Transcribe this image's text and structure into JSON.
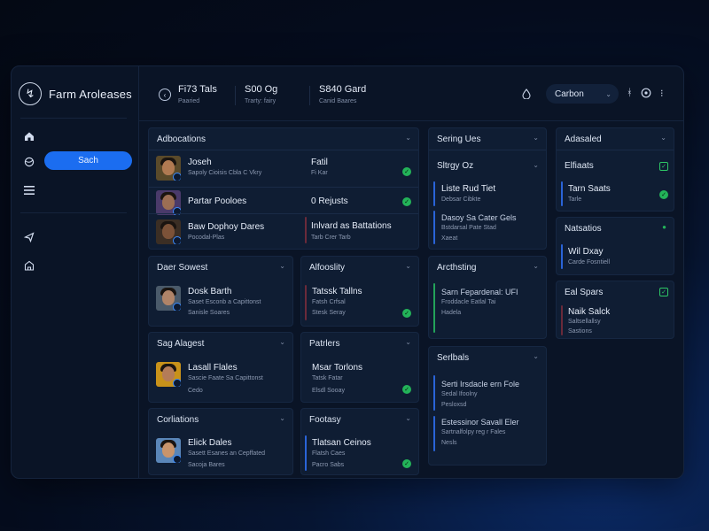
{
  "app": {
    "brand_mark": "↯",
    "title": "Farm Aroleases"
  },
  "sidebar": {
    "search_label": "Sach"
  },
  "topbar": {
    "stats": [
      {
        "value": "Fi73 Tals",
        "label": "Paaried"
      },
      {
        "value": "S00 Og",
        "label": "Trarty: fairy"
      },
      {
        "value": "S840 Gard",
        "label": "Canid Baares"
      }
    ],
    "select_value": "Carbon"
  },
  "cards": {
    "adbocations": {
      "title": "Adbocations",
      "rows": [
        {
          "name": "Joseh",
          "sub": "Sapoly Cioisis Cbla C Vkry",
          "right_title": "Fatil",
          "right_sub": "Fi Kar"
        },
        {
          "name": "Partar Pooloes",
          "right_title": "0 Rejusts"
        },
        {
          "name": "Baw Dophoy Dares",
          "sub": "Pocodal-Plas",
          "right_title": "Inlvard as Battations",
          "right_sub": "Tarb Crer Tarb"
        }
      ]
    },
    "daer": {
      "title": "Daer Sowest",
      "name": "Dosk Barth",
      "sub1": "Saset Esconb a Capittonst",
      "sub2": "Sanisle Soares"
    },
    "sag": {
      "title": "Sag Alagest",
      "name": "Lasall Flales",
      "sub1": "Sascie Faate Sa Capittonst",
      "sub2": "Cedo"
    },
    "corlations": {
      "title": "Corliations",
      "name": "Elick Dales",
      "sub1": "Sasett Esanes an Cepffated",
      "sub2": "Sacoja Bares"
    },
    "alfooslity": {
      "title": "Alfooslity",
      "name": "Tatssk Tallns",
      "sub1": "Fatsh Crfsal",
      "sub2": "Stesk Seray"
    },
    "patrlers": {
      "title": "Patrlers",
      "name": "Msar Torlons",
      "sub1": "Tatsk Fatar",
      "sub2": "Elsdl Sooay"
    },
    "footasy": {
      "title": "Footasy",
      "name": "Tlatsan Ceinos",
      "sub1": "Flatsh Caes",
      "sub2": "Pacro Sabs"
    },
    "sering": {
      "title": "Sering Ues",
      "sub_title": "Sltrgy Oz",
      "lines1": [
        "Liste Rud Tiet",
        "Debsar Cibkte"
      ],
      "lines2": [
        "Dasoy Sa Cater Gels",
        "Bstdarsal Pate Stad",
        "Xaeat"
      ]
    },
    "archsting": {
      "title": "Arcthsting",
      "lines": [
        "Sarn Fepardenal: UFI",
        "Froddacle Eatlal Tai",
        "Hadela"
      ]
    },
    "serlbals": {
      "title": "Serlbals",
      "lines1": [
        "Serti Irsdacle ern Fole",
        "Sedal Ifoolny",
        "Pesloxsd"
      ],
      "lines2": [
        "Estessinor Savall Eler",
        "Sartnalfolpy reg r Fales",
        "Nesls"
      ]
    },
    "adasaled": {
      "title": "Adasaled",
      "sub_title": "Elfiaats",
      "name": "Tarn Saats",
      "sub": "Tarle"
    },
    "natsatios": {
      "title": "Natsatios",
      "name": "Wil Dxay",
      "sub": "Carde Fosntiell"
    },
    "solspars": {
      "title": "Eal Spars",
      "name": "Naik Salck",
      "sub1": "Saltsellallsy",
      "sub2": "Sastions"
    }
  },
  "colors": {
    "accent": "#1b6df0",
    "success": "#23b359",
    "accent_bar_blue": "#2a64d8",
    "accent_bar_green": "#23a35a",
    "accent_bar_red": "#6a2a3a"
  }
}
